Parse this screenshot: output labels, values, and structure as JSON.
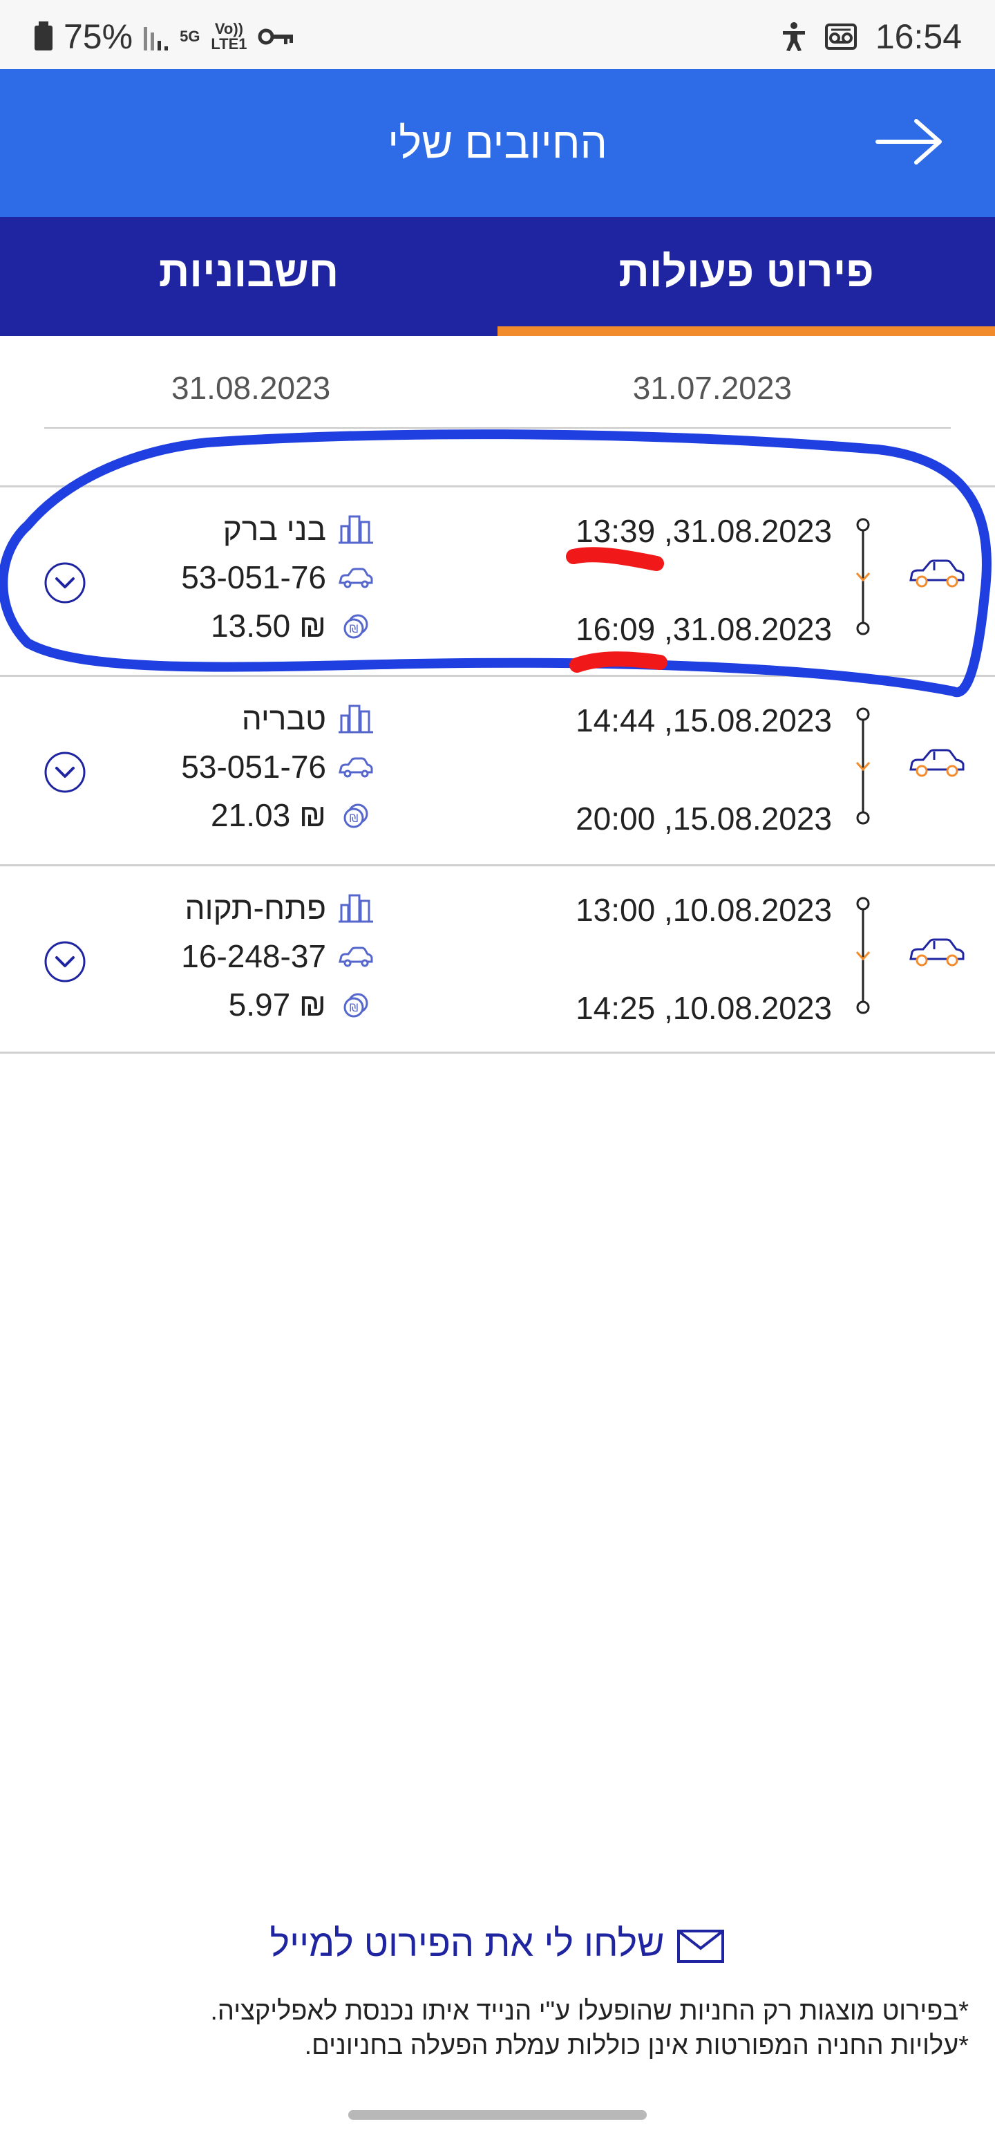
{
  "status_bar": {
    "battery": "75%",
    "network_5g": "5G",
    "network_lte": "Vo)) LTE1",
    "time": "16:54"
  },
  "header": {
    "title": "החיובים שלי"
  },
  "tabs": [
    {
      "label": "פירוט פעולות",
      "active": true
    },
    {
      "label": "חשבוניות",
      "active": false
    }
  ],
  "date_range": {
    "from": "31.07.2023",
    "to": "31.08.2023"
  },
  "transactions": [
    {
      "start": "13:39 ,31.08.2023",
      "end": "16:09 ,31.08.2023",
      "city": "בני ברק",
      "plate": "53-051-76",
      "amount": "13.50 ₪"
    },
    {
      "start": "14:44 ,15.08.2023",
      "end": "20:00 ,15.08.2023",
      "city": "טבריה",
      "plate": "53-051-76",
      "amount": "21.03 ₪"
    },
    {
      "start": "13:00 ,10.08.2023",
      "end": "14:25 ,10.08.2023",
      "city": "פתח-תקוה",
      "plate": "16-248-37",
      "amount": "5.97 ₪"
    }
  ],
  "footer": {
    "email_link": "שלחו לי את הפירוט למייל",
    "note1": "*בפירוט מוצגות רק החניות שהופעלו ע\"י הנייד איתו נכנסת לאפליקציה.",
    "note2": "*עלויות החניה המפורטות אינן כוללות עמלת הפעלה בחניונים."
  },
  "colors": {
    "header_blue": "#2e6be6",
    "tab_navy": "#1f24a0",
    "tab_indicator_orange": "#f28b2c",
    "annotation_blue": "#1f3fe0",
    "annotation_red": "#f01818"
  }
}
